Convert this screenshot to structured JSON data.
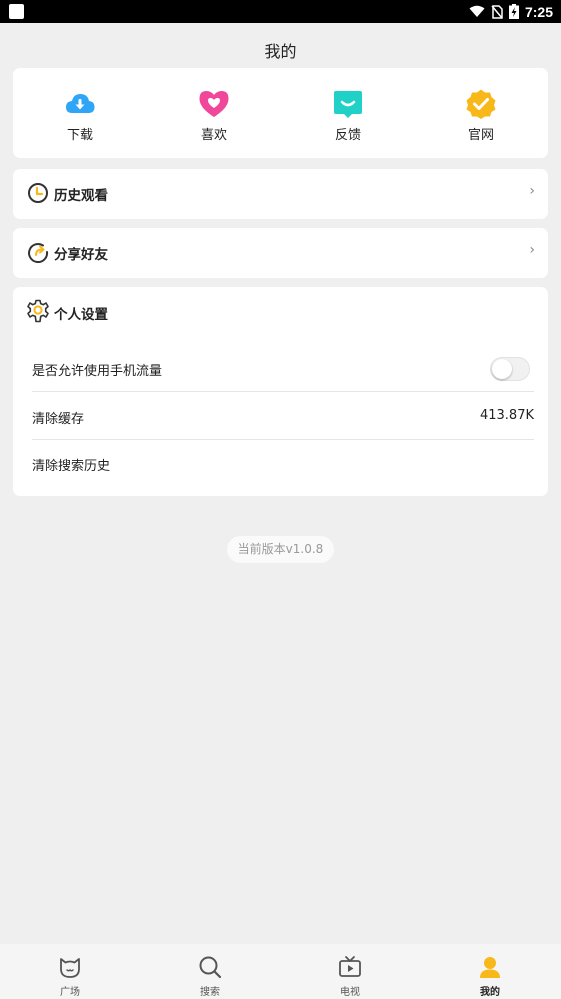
{
  "status_bar": {
    "time": "7:25"
  },
  "page": {
    "title": "我的"
  },
  "quick_actions": [
    {
      "label": "下载",
      "icon": "cloud-download-icon",
      "color": "#2ea6f5"
    },
    {
      "label": "喜欢",
      "icon": "heart-icon",
      "color": "#f0479a"
    },
    {
      "label": "反馈",
      "icon": "feedback-chat-icon",
      "color": "#1fd1c7"
    },
    {
      "label": "官网",
      "icon": "verified-badge-icon",
      "color": "#f9b81a"
    }
  ],
  "history": {
    "label": "历史观看",
    "icon": "clock-icon"
  },
  "share": {
    "label": "分享好友",
    "icon": "share-icon"
  },
  "settings": {
    "title": "个人设置",
    "icon": "gear-icon",
    "mobile_data": {
      "label": "是否允许使用手机流量",
      "enabled": false
    },
    "clear_cache": {
      "label": "清除缓存",
      "value": "413.87K"
    },
    "clear_search": {
      "label": "清除搜索历史"
    }
  },
  "version": {
    "text": "当前版本v1.0.8"
  },
  "tabbar": {
    "items": [
      {
        "label": "广场",
        "icon": "cat-face-icon",
        "active": false
      },
      {
        "label": "搜索",
        "icon": "search-icon",
        "active": false
      },
      {
        "label": "电视",
        "icon": "tv-icon",
        "active": false
      },
      {
        "label": "我的",
        "icon": "user-icon",
        "active": true
      }
    ]
  },
  "colors": {
    "accent": "#f9b81a",
    "background": "#efefef"
  }
}
